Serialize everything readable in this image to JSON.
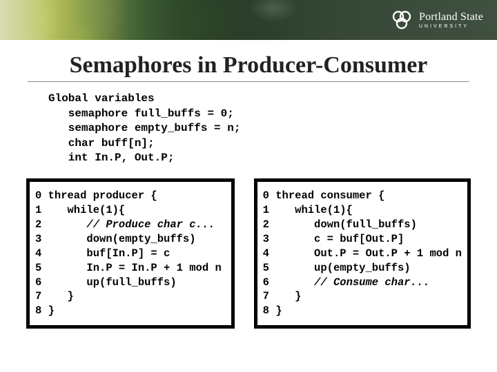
{
  "header": {
    "logo_name": "Portland State",
    "logo_sub": "UNIVERSITY"
  },
  "title": "Semaphores in Producer-Consumer",
  "globals": "Global variables\n   semaphore full_buffs = 0;\n   semaphore empty_buffs = n;\n   char buff[n];\n   int In.P, Out.P;",
  "producer": {
    "l0": "0 thread producer {",
    "l1": "1    while(1){",
    "l2_pre": "2       ",
    "l2_c": "// Produce char c...",
    "l3": "3       down(empty_buffs)",
    "l4": "4       buf[In.P] = c",
    "l5": "5       In.P = In.P + 1 mod n",
    "l6": "6       up(full_buffs)",
    "l7": "7    }",
    "l8": "8 }"
  },
  "consumer": {
    "l0": "0 thread consumer {",
    "l1": "1    while(1){",
    "l2": "2       down(full_buffs)",
    "l3": "3       c = buf[Out.P]",
    "l4": "4       Out.P = Out.P + 1 mod n",
    "l5": "5       up(empty_buffs)",
    "l6_pre": "6       ",
    "l6_c": "// Consume char...",
    "l7": "7    }",
    "l8": "8 }"
  }
}
